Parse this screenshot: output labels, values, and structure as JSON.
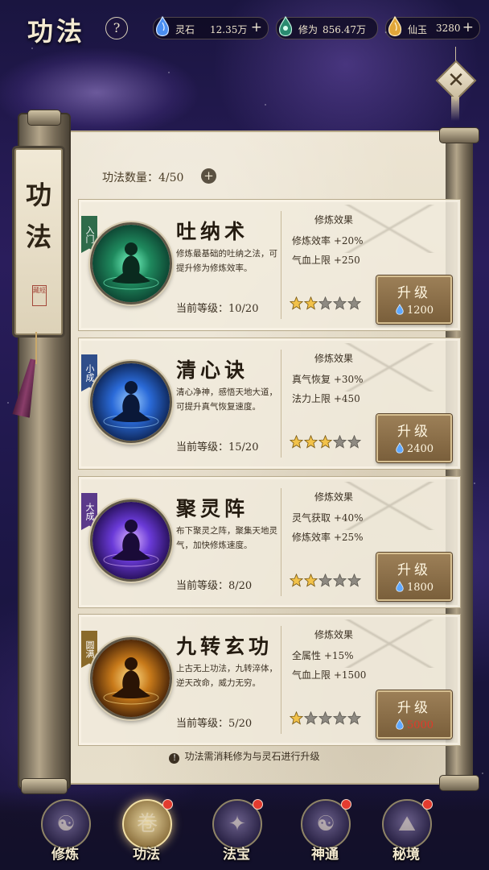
{
  "header": {
    "title": "功法",
    "help_label": "?",
    "resources": [
      {
        "name": "灵石",
        "value": "12.35万",
        "icon": "spirit-stone-icon",
        "color": "#5fa8ff"
      },
      {
        "name": "修为",
        "value": "856.47万",
        "icon": "cultivation-icon",
        "color": "#52d6b2"
      },
      {
        "name": "仙玉",
        "value": "3280",
        "icon": "immortal-jade-icon",
        "color": "#f2c14e"
      }
    ],
    "plus_label": "+",
    "close_label": "✕"
  },
  "scroll": {
    "plaque_title": "功法",
    "seal_text": "藏經"
  },
  "skill_count": {
    "label": "功法数量：4/50",
    "plus_label": "+"
  },
  "effect_title": "修炼效果",
  "upgrade_label": "升级",
  "skills": [
    {
      "rank": "入门",
      "rank_color": "#2f6b4a",
      "name": "吐纳术",
      "desc": "修炼最基础的吐纳之法，可提升修为修炼效率。",
      "level": "当前等级：10/20",
      "effects": [
        "修炼效率 +20%",
        "气血上限 +250"
      ],
      "stars": 2,
      "max_stars": 5,
      "cost": "1200",
      "cost_insufficient": false,
      "theme": "green"
    },
    {
      "rank": "小成",
      "rank_color": "#2f4e8a",
      "name": "清心诀",
      "desc": "清心净神，感悟天地大道，可提升真气恢复速度。",
      "level": "当前等级：15/20",
      "effects": [
        "真气恢复 +30%",
        "法力上限 +450"
      ],
      "stars": 3,
      "max_stars": 5,
      "cost": "2400",
      "cost_insufficient": false,
      "theme": "blue"
    },
    {
      "rank": "大成",
      "rank_color": "#5b3a8a",
      "name": "聚灵阵",
      "desc": "布下聚灵之阵，聚集天地灵气，加快修炼速度。",
      "level": "当前等级：8/20",
      "effects": [
        "灵气获取 +40%",
        "修炼效率 +25%"
      ],
      "stars": 2,
      "max_stars": 5,
      "cost": "1800",
      "cost_insufficient": false,
      "theme": "purple"
    },
    {
      "rank": "圆满",
      "rank_color": "#8a6a2a",
      "name": "九转玄功",
      "desc": "上古无上功法，九转淬体，逆天改命，威力无穷。",
      "level": "当前等级：5/20",
      "effects": [
        "全属性 +15%",
        "气血上限 +1500"
      ],
      "stars": 1,
      "max_stars": 5,
      "cost": "5000",
      "cost_insufficient": true,
      "theme": "gold"
    }
  ],
  "note": "功法需消耗修为与灵石进行升级",
  "nav": [
    {
      "label": "修炼",
      "icon": "meditation-icon",
      "active": false,
      "badge": false
    },
    {
      "label": "功法",
      "icon": "scroll-book-icon",
      "active": true,
      "badge": true
    },
    {
      "label": "法宝",
      "icon": "treasure-icon",
      "active": false,
      "badge": true
    },
    {
      "label": "神通",
      "icon": "taiji-icon",
      "active": false,
      "badge": true
    },
    {
      "label": "秘境",
      "icon": "mountain-realm-icon",
      "active": false,
      "badge": true
    }
  ]
}
